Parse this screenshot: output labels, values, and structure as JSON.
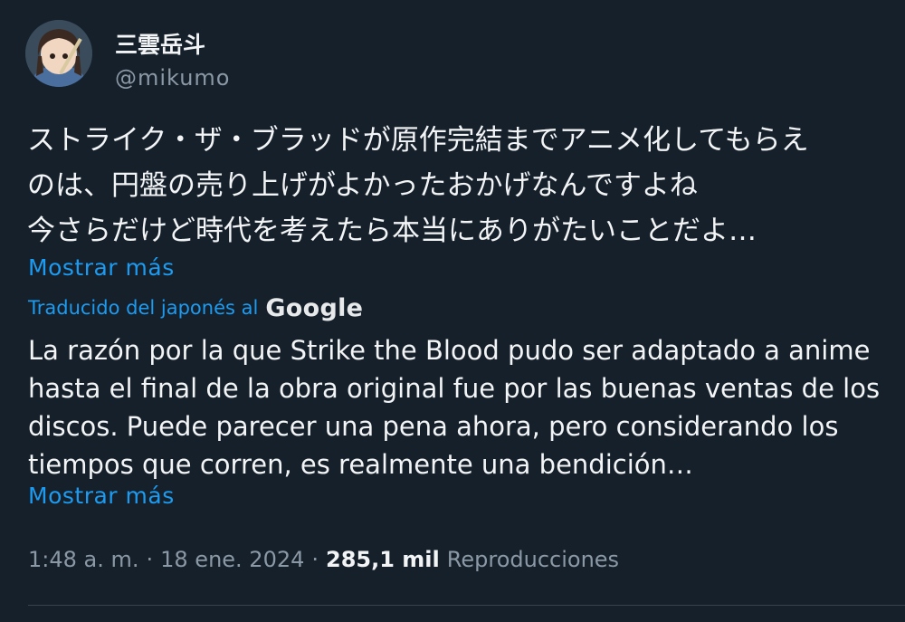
{
  "tweet": {
    "author": {
      "display_name": "三雲岳斗",
      "handle": "@mikumo",
      "avatar_icon": "anime-avatar-icon"
    },
    "text_lines": [
      "ストライク・ザ・ブラッドが原作完結までアニメ化してもらえ",
      "のは、円盤の売り上げがよかったおかげなんですよね",
      "今さらだけど時代を考えたら本当にありがたいことだよ…"
    ],
    "show_more_label": "Mostrar más",
    "translation": {
      "label": "Traducido del japonés al",
      "provider": "Google",
      "lines": [
        "La razón por la que Strike the Blood pudo ser adaptado a anime",
        "hasta el final de la obra original fue por las buenas ventas de los",
        "discos. Puede parecer una pena ahora, pero considerando los",
        "tiempos que corren, es realmente una bendición…"
      ],
      "show_more_label": "Mostrar más"
    },
    "meta": {
      "time": "1:48 a. m.",
      "separator": "·",
      "date": "18 ene. 2024",
      "views_count": "285,1 mil",
      "views_label": "Reproducciones"
    }
  },
  "colors": {
    "background": "#15202b",
    "link": "#1d9bf0",
    "muted": "#8b98a5",
    "text": "#f2f4f5"
  }
}
